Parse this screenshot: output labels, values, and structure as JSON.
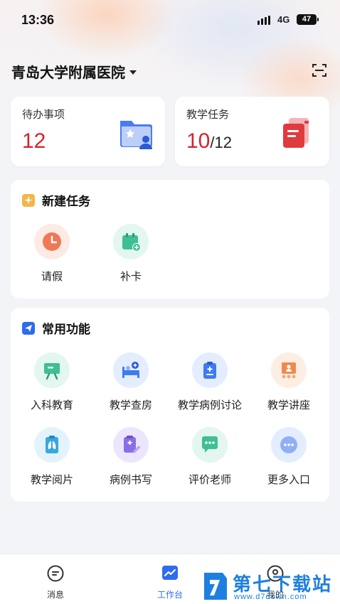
{
  "status_bar": {
    "time": "13:36",
    "network": "4G",
    "battery": "47"
  },
  "header": {
    "hospital_name": "青岛大学附属医院"
  },
  "stats": {
    "todo": {
      "label": "待办事项",
      "value": "12"
    },
    "teaching": {
      "label": "教学任务",
      "value": "10",
      "total": "/12"
    }
  },
  "new_task": {
    "title": "新建任务",
    "items": [
      {
        "label": "请假",
        "icon": "clock-icon"
      },
      {
        "label": "补卡",
        "icon": "calendar-add-icon"
      }
    ]
  },
  "common": {
    "title": "常用功能",
    "items": [
      {
        "label": "入科教育",
        "icon": "teaching-board-icon"
      },
      {
        "label": "教学查房",
        "icon": "hospital-bed-icon"
      },
      {
        "label": "教学病例讨论",
        "icon": "clipboard-plus-icon"
      },
      {
        "label": "教学讲座",
        "icon": "lecture-icon"
      },
      {
        "label": "教学阅片",
        "icon": "xray-film-icon"
      },
      {
        "label": "病例书写",
        "icon": "case-writing-icon"
      },
      {
        "label": "评价老师",
        "icon": "chat-bubble-icon"
      },
      {
        "label": "更多入口",
        "icon": "more-icon"
      }
    ]
  },
  "tabbar": {
    "items": [
      {
        "label": "消息",
        "icon": "message-icon"
      },
      {
        "label": "工作台",
        "icon": "workbench-icon",
        "active": true
      },
      {
        "label": "我的",
        "icon": "profile-icon"
      }
    ]
  },
  "watermark": {
    "text": "第七下载站",
    "url": "www.d7down.com"
  },
  "colors": {
    "accent": "#2f6bf0",
    "alert": "#d8232a"
  }
}
